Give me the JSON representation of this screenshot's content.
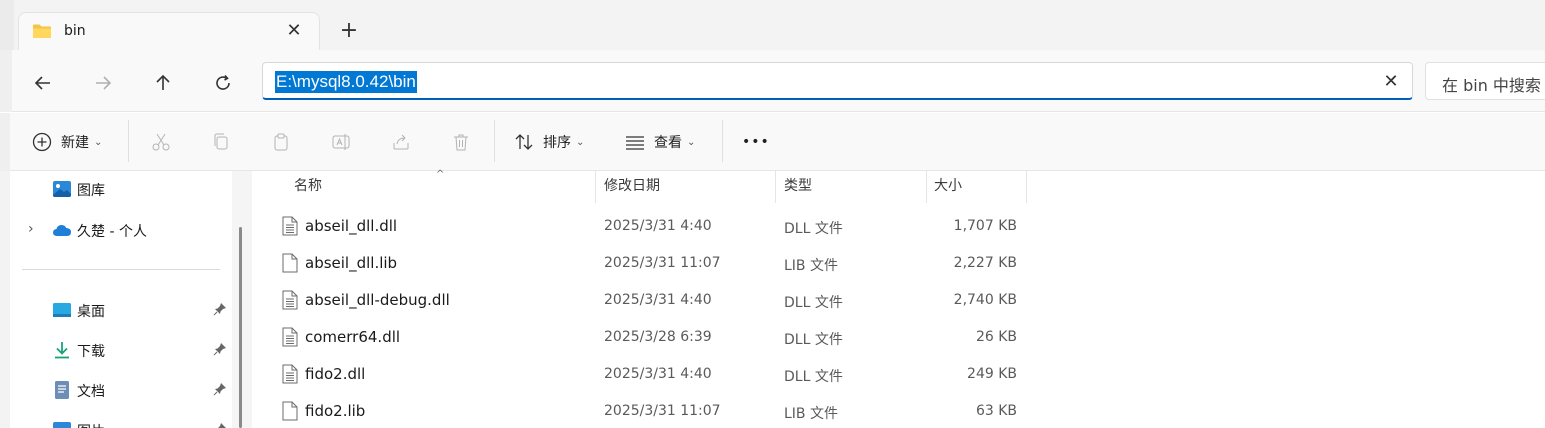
{
  "tab": {
    "title": "bin",
    "close_glyph": "✕",
    "new_glyph": "+"
  },
  "nav": {
    "back_icon": "arrow-left-icon",
    "forward_icon": "arrow-right-icon",
    "up_icon": "arrow-up-icon",
    "refresh_icon": "refresh-icon"
  },
  "address": {
    "value": "E:\\mysql8.0.42\\bin",
    "clear_glyph": "✕"
  },
  "search": {
    "placeholder": "在 bin 中搜索"
  },
  "toolbar": {
    "new_label": "新建",
    "sort_label": "排序",
    "view_label": "查看",
    "more_glyph": "•••",
    "chevron": "⌄"
  },
  "sidebar": {
    "items": [
      {
        "label": "图库",
        "icon": "gallery-icon"
      },
      {
        "label": "久楚 - 个人",
        "icon": "onedrive-cloud-icon"
      },
      {
        "label": "桌面",
        "icon": "desktop-icon"
      },
      {
        "label": "下载",
        "icon": "download-icon"
      },
      {
        "label": "文档",
        "icon": "document-icon"
      },
      {
        "label": "图片",
        "icon": "pictures-icon"
      }
    ],
    "expand_glyph": "›",
    "pin_glyph": "📌"
  },
  "columns": {
    "name": "名称",
    "modified": "修改日期",
    "type": "类型",
    "size": "大小",
    "sort_caret": "^"
  },
  "files": [
    {
      "name": "abseil_dll.dll",
      "modified": "2025/3/31 4:40",
      "type": "DLL 文件",
      "size": "1,707 KB",
      "kind": "dll"
    },
    {
      "name": "abseil_dll.lib",
      "modified": "2025/3/31 11:07",
      "type": "LIB 文件",
      "size": "2,227 KB",
      "kind": "lib"
    },
    {
      "name": "abseil_dll-debug.dll",
      "modified": "2025/3/31 4:40",
      "type": "DLL 文件",
      "size": "2,740 KB",
      "kind": "dll"
    },
    {
      "name": "comerr64.dll",
      "modified": "2025/3/28 6:39",
      "type": "DLL 文件",
      "size": "26 KB",
      "kind": "dll"
    },
    {
      "name": "fido2.dll",
      "modified": "2025/3/31 4:40",
      "type": "DLL 文件",
      "size": "249 KB",
      "kind": "dll"
    },
    {
      "name": "fido2.lib",
      "modified": "2025/3/31 11:07",
      "type": "LIB 文件",
      "size": "63 KB",
      "kind": "lib"
    }
  ],
  "colors": {
    "accent": "#005fb8",
    "selection": "#0078d4",
    "folder": "#f4c542"
  }
}
